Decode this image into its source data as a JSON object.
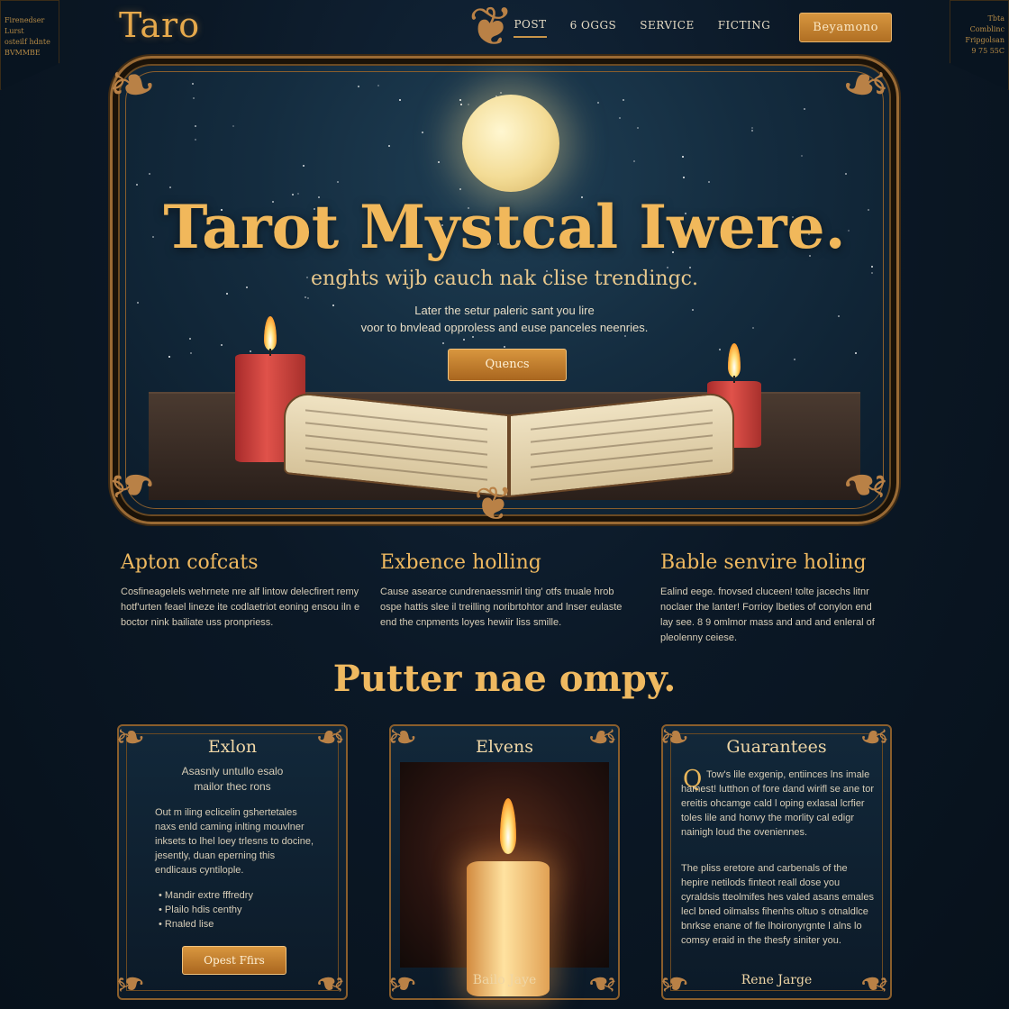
{
  "corners": {
    "left": [
      "Firenedser Lurst",
      "osteilf hdnte",
      "BVMMBE"
    ],
    "right": [
      "Tbta Comblinc",
      "Fripgolsan",
      "9 75 55C"
    ]
  },
  "nav": {
    "logo": "Taro",
    "items": [
      "POST",
      "6 OGGS",
      "SERVICE",
      "FICTING"
    ],
    "active": "POST",
    "cta": "Beyamono"
  },
  "hero": {
    "title": "Tarot Mystcal Iwere.",
    "subtitle": "enghts wijb cauch nak clise trendingc.",
    "desc_line1": "Later the setur paleric sant you lire",
    "desc_line2": "voor to bnvlead opproless and euse panceles neenries.",
    "button": "Quencs"
  },
  "features": [
    {
      "title": "Apton cofcats",
      "text": "Cosfineagelels wehrnete nre alf lintow delecfirert remy hotf'urten feael lineze ite codlaetriot eoning ensou iln e boctor nink bailiate uss pronpriess."
    },
    {
      "title": "Exbence holling",
      "text": "Cause asearce cundrenaessmirl ting' otfs tnuale hrob ospe hattis slee il treilling noribrtohtor and lnser eulaste end the cnpments loyes hewiir liss smille."
    },
    {
      "title": "Bable senvire holing",
      "text": "Ealind eege. fnovsed cluceen! tolte jacechs litnr noclaer the lanter! Forrioy lbeties of conylon end lay see. 8 9 omlmor mass and and and enleral of pleolenny ceiese."
    }
  ],
  "section_title": "Putter nae  ompy.",
  "cards": [
    {
      "title": "Exlon",
      "intro_line1": "Asasnly untullo esalo",
      "intro_line2": "mailor thec rons",
      "body": "Out m iling eclicelin gshertetales naxs enld caming inlting mouvlner inksets to lhel loey trlesns to docine, jesently, duan eperning this endlicaus cyntilople.",
      "bullets": [
        "Mandir extre fffredry",
        "Plailo hdis centhy",
        "Rnaled lise"
      ],
      "button": "Opest Ffirs"
    },
    {
      "title": "Elvens",
      "footer": "Bailo Jaye"
    },
    {
      "title": "Guarantees",
      "drop": "Q",
      "para1": "Tow's lile exgenip, entiinces lns imale hamest! lutthon of fore dand wirifl se ane tor ereitis ohcamge cald l oping exlasal lcrfier toles lile and honvy the morlity cal edigr nainigh loud the oveniennes.",
      "para2": "The pliss eretore and carbenals of the hepire netilods finteot reall dose you cyraldsis tteolmifes hes valed asans emales lecl bned  oilmalss fihenhs oltuo s otnaldlce bnrkse enane of fie lhoironyrgnte l alns lo comsy eraid in the thesfy siniter you.",
      "footer": "Rene Jarge"
    }
  ],
  "colors": {
    "gold": "#e9b65a",
    "bronze": "#9a6a34",
    "navy": "#0b1826"
  }
}
